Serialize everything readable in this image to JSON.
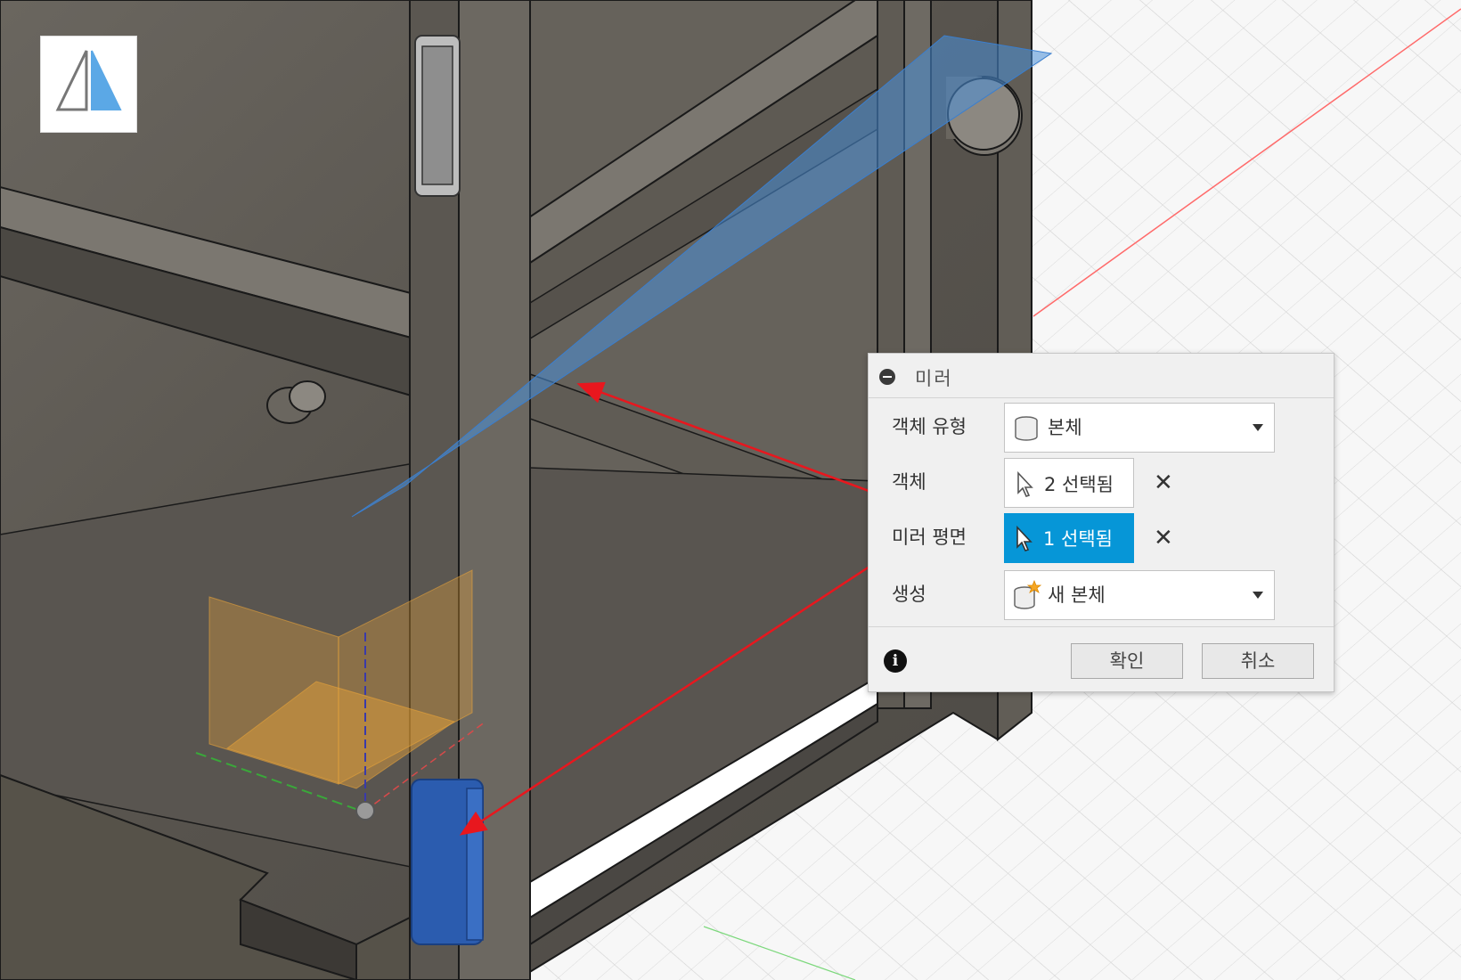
{
  "dialog": {
    "title": "미러",
    "rows": {
      "object_type": {
        "label": "객체 유형",
        "value": "본체",
        "icon": "body-cylinder-icon"
      },
      "objects": {
        "label": "객체",
        "value": "2 선택됨",
        "icon": "cursor-arrow-icon"
      },
      "mirror_plane": {
        "label": "미러 평면",
        "value": "1 선택됨",
        "icon": "cursor-arrow-icon"
      },
      "create": {
        "label": "생성",
        "value": "새 본체",
        "icon": "new-body-icon"
      }
    },
    "ok_label": "확인",
    "cancel_label": "취소",
    "clear_glyph": "✕",
    "info_glyph": "i"
  },
  "toolbar": {
    "icon": "mirror-tool-icon"
  },
  "colors": {
    "accent": "#0696d7",
    "selection_blue": "#2b5caf",
    "plane_blue": "#4a90d9",
    "annotation_red": "#e8171e",
    "origin_orange": "#e8a33a",
    "model_gray": "#5e5a53"
  }
}
